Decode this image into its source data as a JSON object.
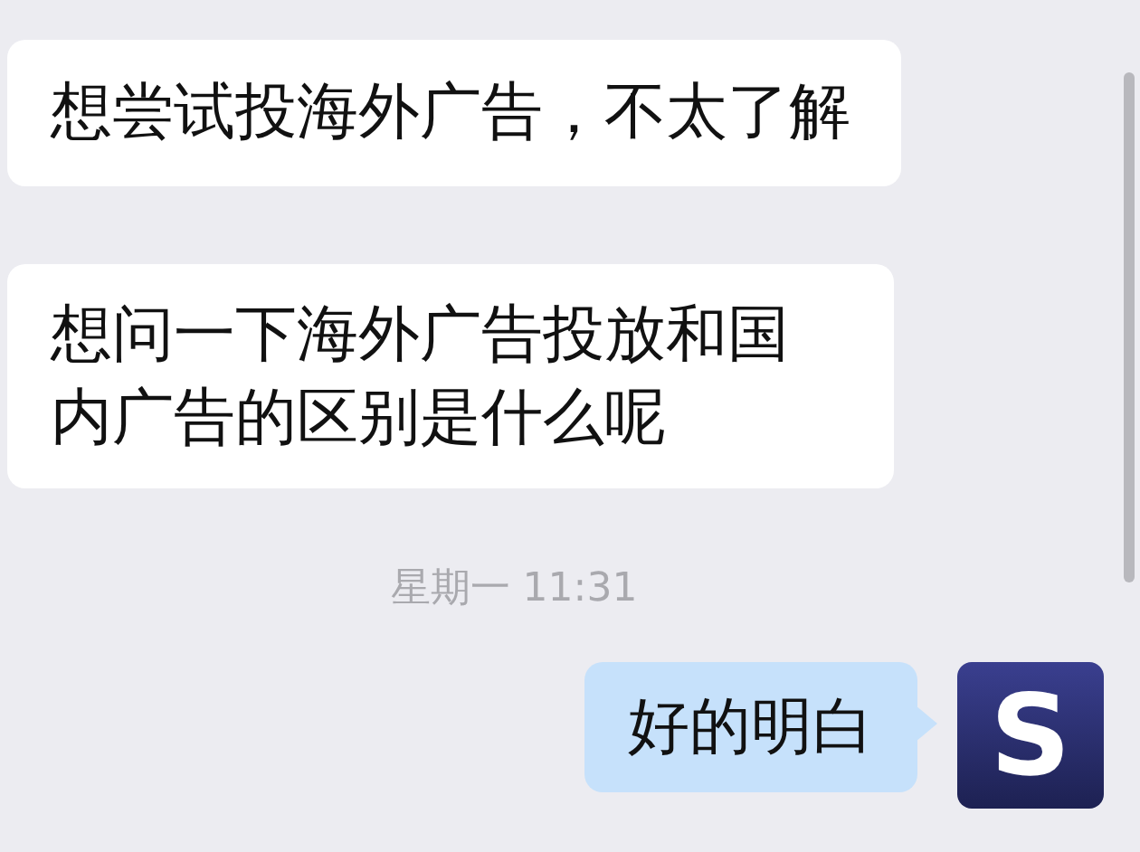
{
  "messages": [
    {
      "kind": "incoming",
      "text": "想尝试投海外广告，不太了解"
    },
    {
      "kind": "incoming",
      "text": "想问一下海外广告投放和国内广告的区别是什么呢"
    },
    {
      "kind": "time",
      "text": "星期一 11:31"
    },
    {
      "kind": "outgoing",
      "text": "好的明白",
      "avatar": "S"
    }
  ]
}
